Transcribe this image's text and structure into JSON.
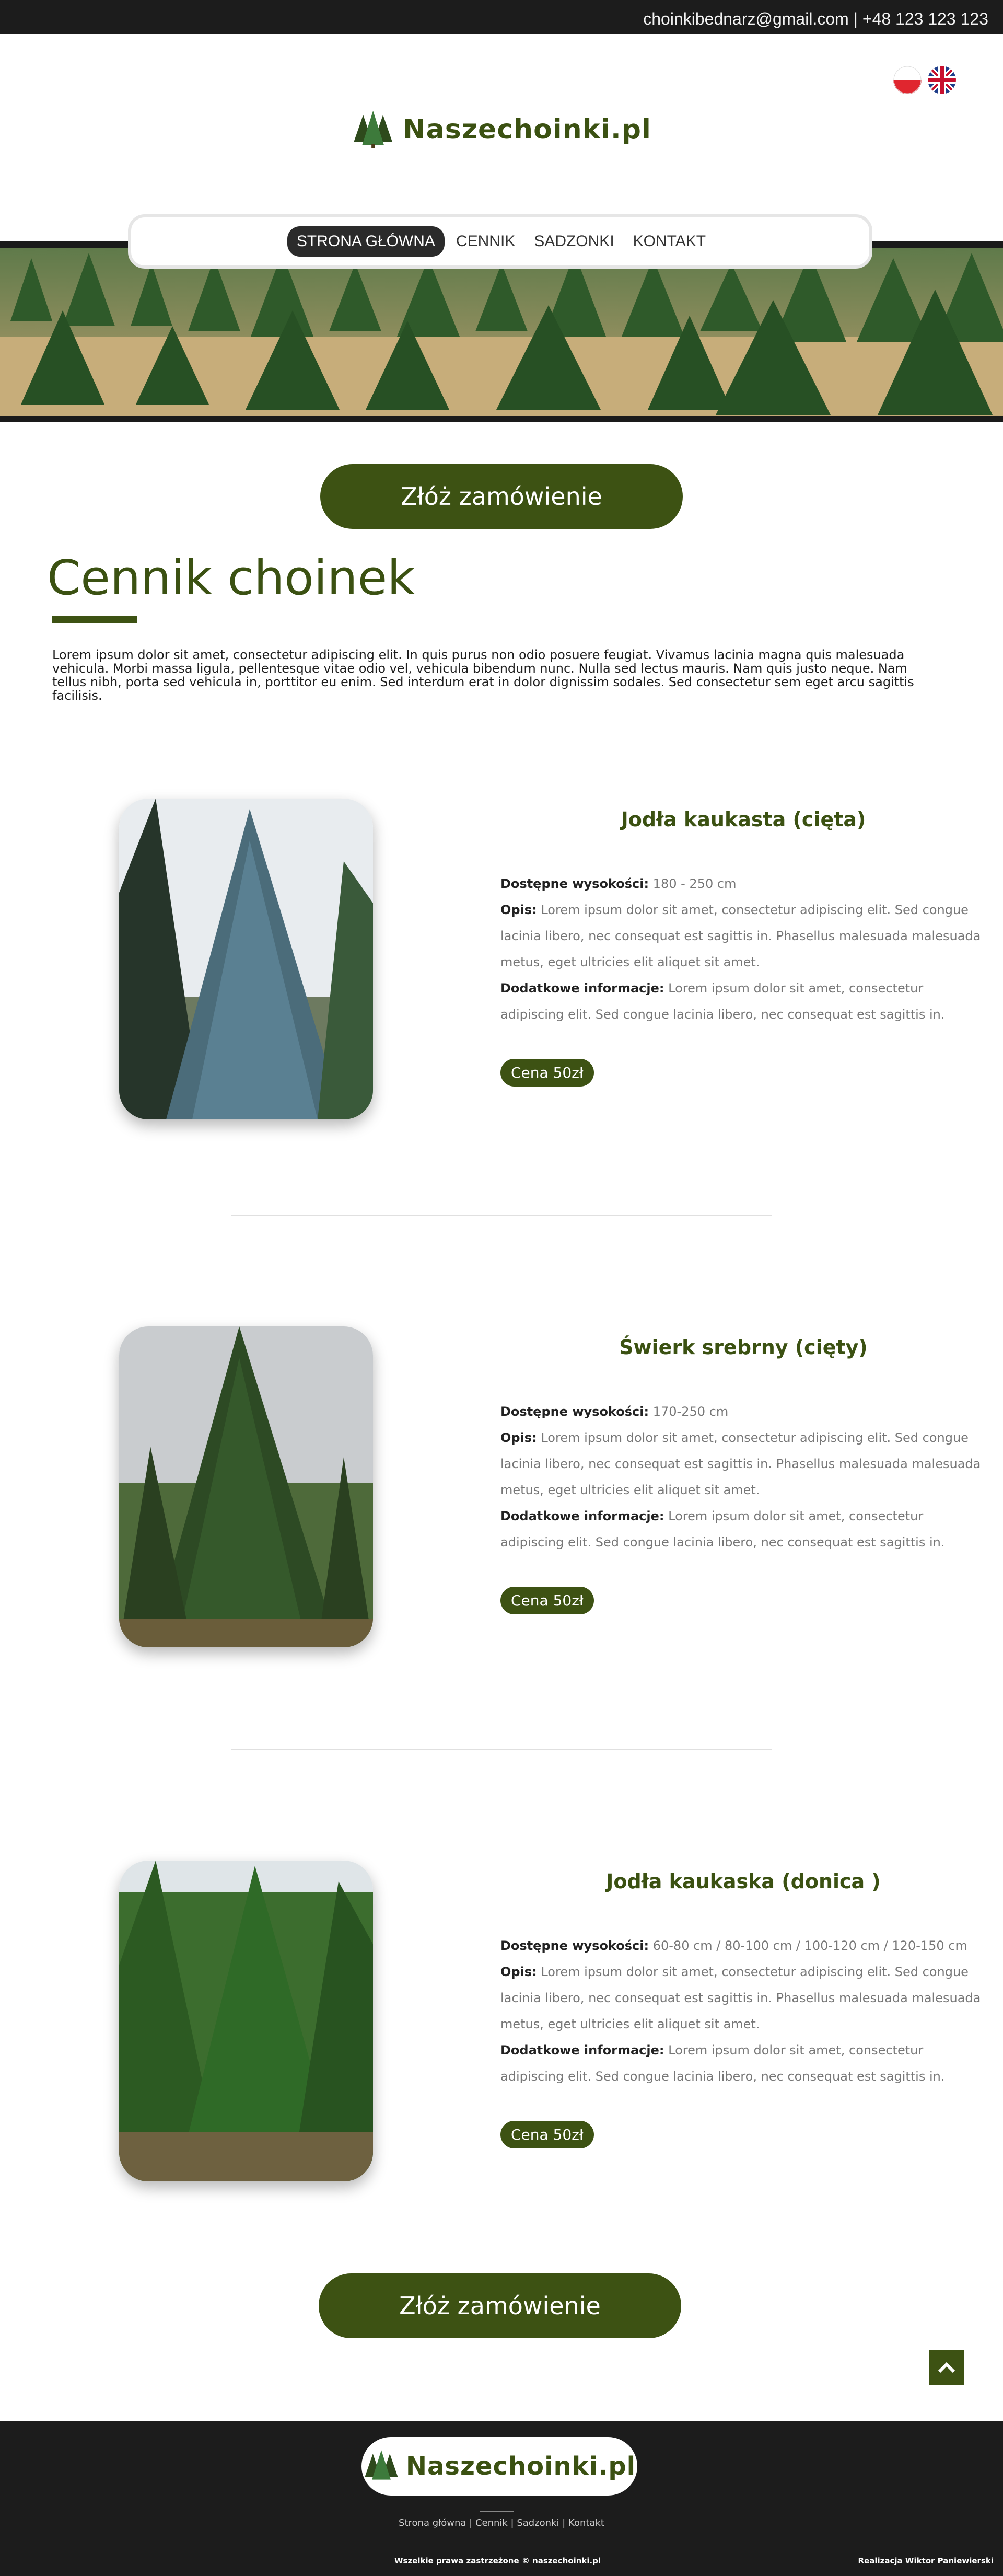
{
  "header": {
    "contact": "choinkibednarz@gmail.com | +48 123 123 123",
    "flags": [
      "poland-flag-icon",
      "uk-flag-icon"
    ]
  },
  "logo": {
    "text": "Naszechoinki.pl",
    "icon": "trees-icon"
  },
  "nav": {
    "items": [
      {
        "label": "STRONA GŁÓWNA",
        "active": true
      },
      {
        "label": "CENNIK",
        "active": false
      },
      {
        "label": "SADZONKI",
        "active": false
      },
      {
        "label": "KONTAKT",
        "active": false
      }
    ]
  },
  "order_button": {
    "label": "Złóż zamówienie"
  },
  "main": {
    "title": "Cennik choinek",
    "intro": "Lorem ipsum dolor sit amet, consectetur adipiscing elit. In quis purus non odio posuere feugiat. Vivamus lacinia magna quis malesuada vehicula. Morbi massa ligula, pellentesque vitae odio vel, vehicula bibendum nunc. Nulla sed lectus mauris. Nam quis justo neque. Nam tellus nibh, porta sed vehicula in, porttitor eu enim. Sed interdum erat in dolor dignissim sodales. Sed consectetur sem eget arcu sagittis facilisis."
  },
  "labels": {
    "heights": "Dostępne wysokości:",
    "description": "Opis:",
    "extra": "Dodatkowe informacje:"
  },
  "products": [
    {
      "name": "Jodła kaukasta (cięta)",
      "heights": "180 - 250 cm",
      "description": "Lorem ipsum dolor sit amet, consectetur adipiscing elit. Sed congue lacinia libero, nec consequat est sagittis in. Phasellus malesuada malesuada metus, eget ultricies elit aliquet sit amet.",
      "extra": "Lorem ipsum dolor sit amet, consectetur adipiscing elit. Sed congue lacinia libero, nec consequat est sagittis in.",
      "price": "Cena 50zł"
    },
    {
      "name": "Świerk srebrny (cięty)",
      "heights": "170-250 cm",
      "description": "Lorem ipsum dolor sit amet, consectetur adipiscing elit. Sed congue lacinia libero, nec consequat est sagittis in. Phasellus malesuada malesuada metus, eget ultricies elit aliquet sit amet.",
      "extra": "Lorem ipsum dolor sit amet, consectetur adipiscing elit. Sed congue lacinia libero, nec consequat est sagittis in.",
      "price": "Cena 50zł"
    },
    {
      "name": "Jodła kaukaska (donica )",
      "heights": "60-80 cm / 80-100 cm / 100-120 cm / 120-150 cm",
      "description": "Lorem ipsum dolor sit amet, consectetur adipiscing elit. Sed congue lacinia libero, nec consequat est sagittis in. Phasellus malesuada malesuada metus, eget ultricies elit aliquet sit amet.",
      "extra": "Lorem ipsum dolor sit amet, consectetur adipiscing elit. Sed congue lacinia libero, nec consequat est sagittis in.",
      "price": "Cena 50zł"
    }
  ],
  "footer": {
    "logo_text": "Naszechoinki.pl",
    "links": [
      "Strona główna",
      "Cennik",
      "Sadzonki",
      "Kontakt"
    ],
    "separator": " | ",
    "copyright": "Wszelkie prawa zastrzeżone © naszechoinki.pl",
    "author": "Realizacja Wiktor Paniewierski"
  },
  "colors": {
    "accent": "#3d5213",
    "dark": "#1c1c1c",
    "title": "#3b5112"
  }
}
